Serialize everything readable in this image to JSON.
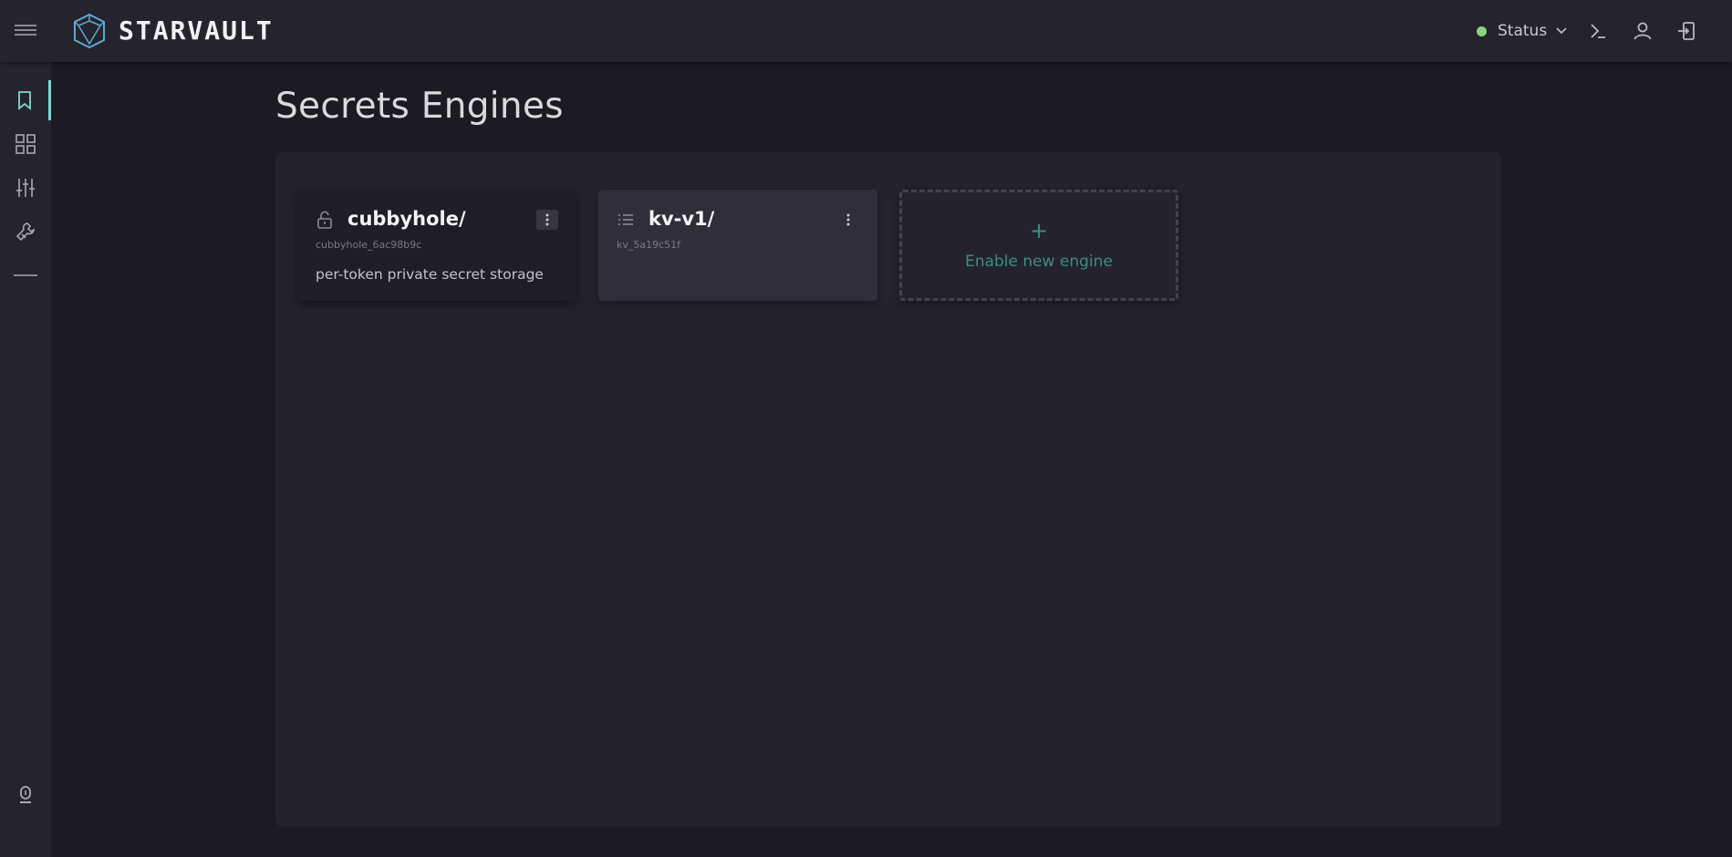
{
  "app": {
    "brand": "STARVAULT",
    "colors": {
      "accent": "#7fd8d2",
      "status_ok": "#8bd37d",
      "enable_text": "#3e8c82"
    }
  },
  "header": {
    "menu_icon": "hamburger-menu-icon",
    "status_label": "Status",
    "icons": [
      "terminal-icon",
      "user-icon",
      "sign-out-icon"
    ]
  },
  "sidebar": {
    "items": [
      {
        "icon": "bookmark-icon",
        "active": true
      },
      {
        "icon": "grid-icon",
        "active": false
      },
      {
        "icon": "sliders-icon",
        "active": false
      },
      {
        "icon": "tools-icon",
        "active": false
      },
      {
        "icon": "minus-icon",
        "active": false
      }
    ],
    "footer_icon": "keyhole-icon"
  },
  "main": {
    "title": "Secrets Engines",
    "engines": [
      {
        "name": "cubbyhole/",
        "id": "cubbyhole_6ac98b9c",
        "description": "per-token private secret storage",
        "icon": "unlock-icon"
      },
      {
        "name": "kv-v1/",
        "id": "kv_5a19c51f",
        "description": "",
        "icon": "list-icon"
      }
    ],
    "enable_plus": "+",
    "enable_label": "Enable new engine"
  }
}
